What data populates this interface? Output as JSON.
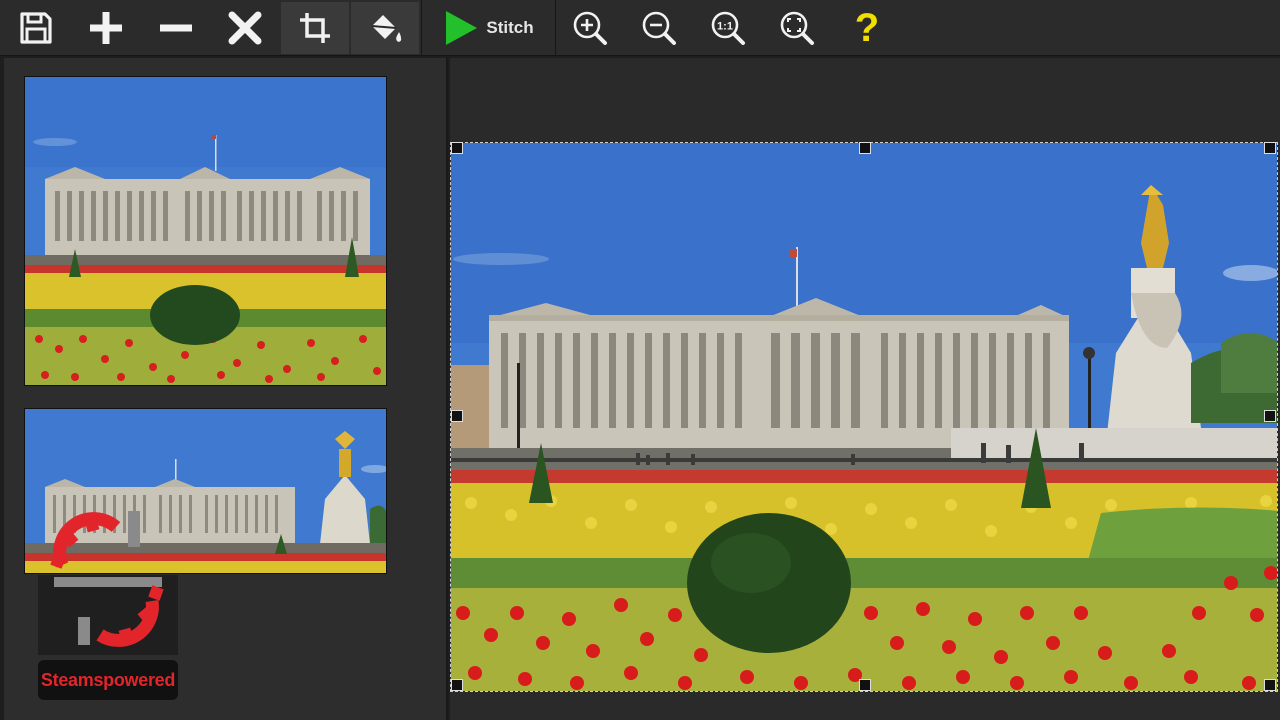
{
  "toolbar": {
    "buttons": [
      {
        "name": "save",
        "icon": "floppy-disk-icon"
      },
      {
        "name": "add",
        "icon": "plus-icon"
      },
      {
        "name": "remove",
        "icon": "minus-icon"
      },
      {
        "name": "delete",
        "icon": "x-icon"
      },
      {
        "name": "crop",
        "icon": "crop-icon"
      },
      {
        "name": "fill",
        "icon": "paint-bucket-icon"
      }
    ],
    "stitch_label": "Stitch",
    "stitch_icon": "play-triangle-icon",
    "zoom_in_icon": "zoom-in-icon",
    "zoom_out_icon": "zoom-out-icon",
    "zoom_actual_label": "1:1",
    "zoom_fit_icon": "zoom-fit-icon",
    "help_label": "?"
  },
  "colors": {
    "accent_green": "#22c02a",
    "help_yellow": "#f2df00",
    "sky": "#3f7ad0",
    "watermark_red": "#e1252b"
  },
  "watermark": {
    "label": "Steamspowered"
  }
}
